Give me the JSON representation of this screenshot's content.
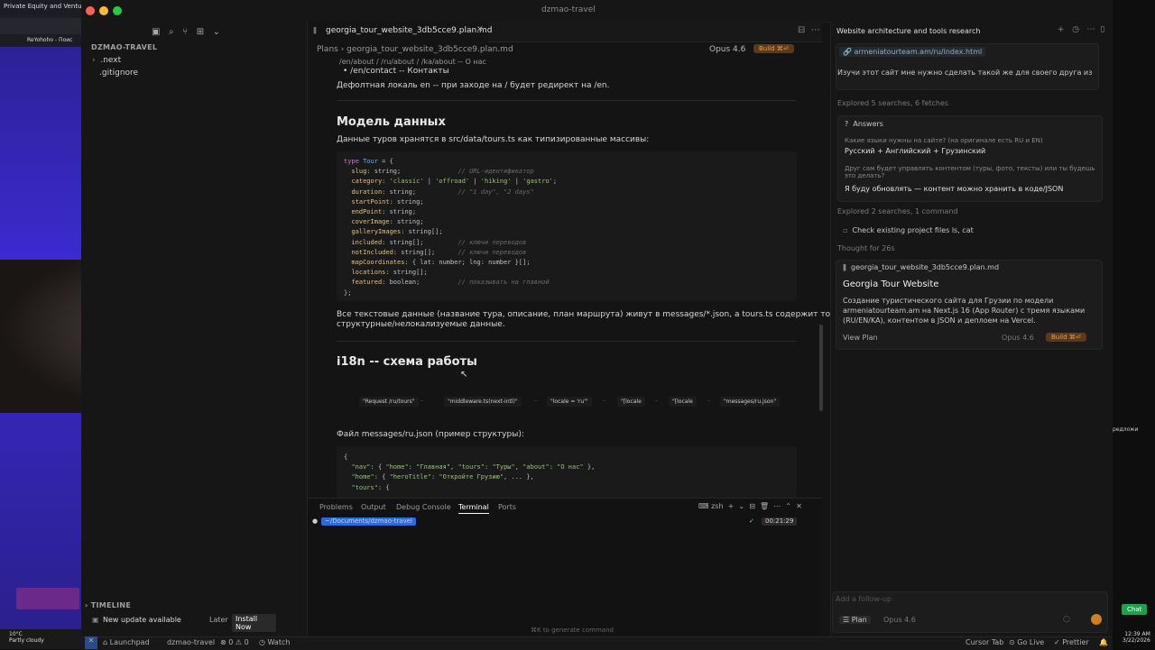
{
  "browser": {
    "tab1": "Private Equity and Ventu",
    "tab2": "ReYohoho - Поис"
  },
  "window": {
    "title": "dzmao-travel"
  },
  "sidebar": {
    "section": "DZMAO-TRAVEL",
    "items": [
      ".next",
      ".gitignore"
    ],
    "timeline": "TIMELINE",
    "update": {
      "text": "New update available",
      "later": "Later",
      "install": "Install Now"
    }
  },
  "editor": {
    "tab": "georgia_tour_website_3db5cce9.plan.md",
    "breadcrumb": "Plans  ›  georgia_tour_website_3db5cce9.plan.md",
    "model": "Opus 4.6",
    "build": "Build ⌘⏎",
    "lines": {
      "route_contact": "/en/contact -- Контакты",
      "default_locale": "Дефолтная локаль en -- при заходе на / будет редирект на /en.",
      "h_model": "Модель данных",
      "model_desc": "Данные туров хранятся в src/data/tours.ts как типизированные массивы:",
      "text_desc": "Все текстовые данные (название тура, описание, план маршрута) живут в messages/*.json, а tours.ts содержит только",
      "text_desc2": "структурные/нелокализуемые данные.",
      "h_i18n": "i18n -- схема работы",
      "file_desc": "Файл messages/ru.json (пример структуры):"
    },
    "flow": [
      "\"Request /ru/tours\"",
      "\"middleware.ts(next-intl)\"",
      "\"locale = 'ru'\"",
      "\"[locale",
      "\"[locale",
      "\"messages/ru.json\""
    ]
  },
  "panel": {
    "tabs": [
      "Problems",
      "Output",
      "Debug Console",
      "Terminal",
      "Ports"
    ],
    "shell": "zsh",
    "path": "~/Documents/dzmao-travel",
    "time": "00:21:29",
    "hint": "⌘K to generate command"
  },
  "agent": {
    "title": "Website architecture and tools research",
    "link": "armeniatourteam.am/ru/index.html",
    "prompt": "Изучи этот сайт мне нужно сделать такой же для своего друга из",
    "explored1": "Explored 5 searches, 6 fetches",
    "answers_title": "Answers",
    "q1": "Какие языки нужны на сайте? (на оригинале есть RU и EN)",
    "a1": "Русский + Английский + Грузинский",
    "q2": "Друг сам будет управлять контентом (туры, фото, тексты) или ты будешь это делать?",
    "a2": "Я буду обновлять — контент можно хранить в коде/JSON",
    "explored2": "Explored 2 searches, 1 command",
    "check": "Check existing project files ls, cat",
    "thought": "Thought for 26s",
    "plan_file": "georgia_tour_website_3db5cce9.plan.md",
    "plan_title": "Georgia Tour Website",
    "plan_desc": "Создание туристического сайта для Грузии по модели armeniatourteam.am на Next.js 16 (App Router) с тремя языками (RU/EN/KA), контентом в JSON и деплоем на Vercel.",
    "view_plan": "View Plan",
    "model": "Opus 4.6",
    "build": "Build ⌘⏎",
    "followup": "Add a follow-up",
    "mode": "Plan",
    "mode_model": "Opus 4.6"
  },
  "status": {
    "launchpad": "Launchpad",
    "project": "dzmao-travel",
    "errors": "⊗ 0 ⚠ 0",
    "watch": "Watch",
    "cursor_tab": "Cursor Tab",
    "go_live": "Go Live",
    "prettier": "Prettier"
  },
  "os": {
    "weather": "10°C",
    "weather_desc": "Partly cloudy",
    "time": "12:39 AM",
    "date": "3/22/2026",
    "chat": "Chat",
    "side_text": "редложи"
  }
}
